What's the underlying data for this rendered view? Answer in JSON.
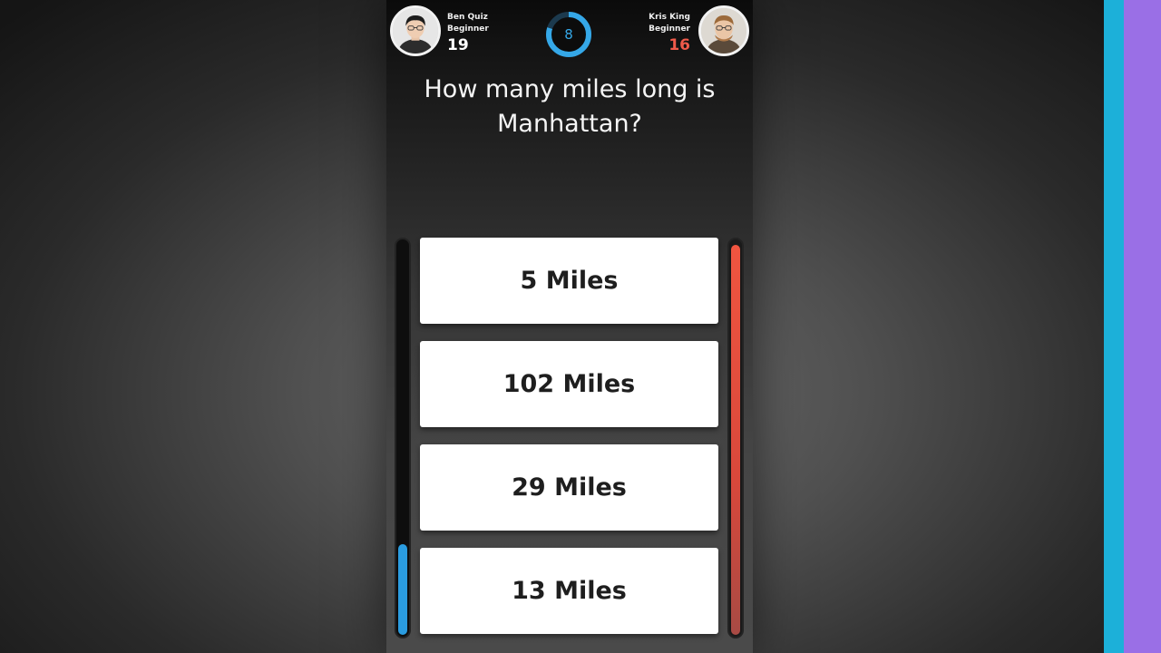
{
  "player1": {
    "name": "Ben Quiz",
    "level": "Beginner",
    "score": "19",
    "progress": 0.23
  },
  "player2": {
    "name": "Kris King",
    "level": "Beginner",
    "score": "16",
    "progress": 0.99
  },
  "timer": {
    "value": "8",
    "fraction_remaining": 0.8
  },
  "question": "How many miles long is Manhattan?",
  "answers": [
    "5 Miles",
    "102 Miles",
    "29 Miles",
    "13 Miles"
  ],
  "colors": {
    "accent": "#35a8e8",
    "player1_bar": "#2a9ce0",
    "player2_bar": "#f05540",
    "player2_score": "#ef5a4a",
    "stripe_cyan": "#1cb0d9",
    "stripe_purple": "#9a6fe6"
  }
}
